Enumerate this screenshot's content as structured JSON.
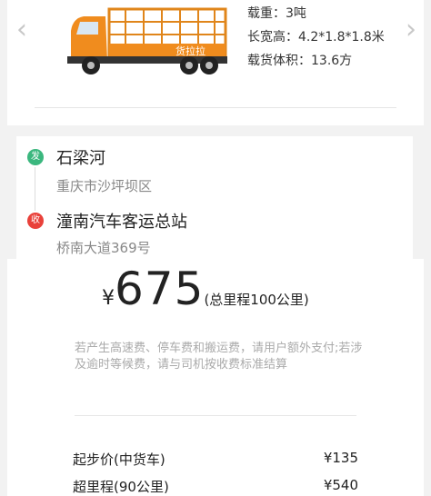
{
  "vehicle": {
    "prev_icon": "chevron-left-icon",
    "next_icon": "chevron-right-icon",
    "prev_glyph": "‹",
    "next_glyph": "›",
    "truck_color": "#f08c1e",
    "truck_brand": "货拉拉",
    "specs": {
      "load": "载重：3吨",
      "dims": "长宽高：4.2*1.8*1.8米",
      "volume": "载货体积：13.6方"
    }
  },
  "route": {
    "from_pin": "发",
    "to_pin": "收",
    "from_name": "石梁河",
    "from_addr": "重庆市沙坪坝区",
    "to_name": "潼南汽车客运总站",
    "to_addr": "桥南大道369号"
  },
  "price": {
    "currency": "¥",
    "total": "675",
    "note": "(总里程100公里)",
    "notice": "若产生高速费、停车费和搬运费，请用户额外支付;若涉及逾时等候费，请与司机按收费标准结算",
    "fees": [
      {
        "label": "起步价(中货车)",
        "amount": "¥135"
      },
      {
        "label": "超里程(90公里)",
        "amount": "¥540"
      }
    ]
  },
  "colors": {
    "accent": "#f08c1e",
    "from": "#3bb77e",
    "to": "#e9413a"
  }
}
